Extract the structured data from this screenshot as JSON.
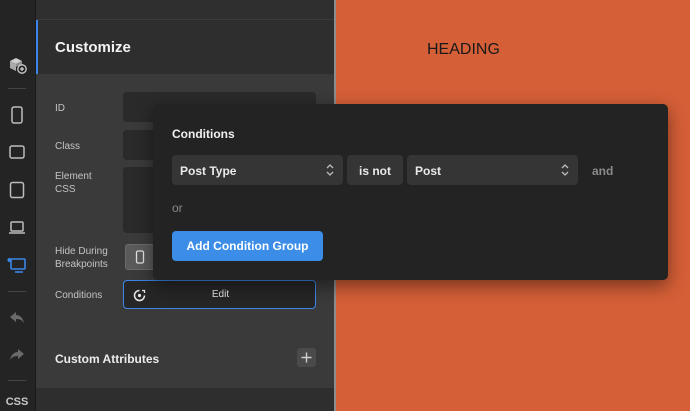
{
  "toolbar": {
    "icons": [
      "add-element-icon",
      "mobile-portrait-icon",
      "tablet-landscape-icon",
      "tablet-portrait-icon",
      "laptop-icon",
      "desktop-icon",
      "undo-icon",
      "redo-icon"
    ],
    "css_label": "CSS"
  },
  "panel": {
    "title": "Customize",
    "fields": {
      "id_label": "ID",
      "class_label": "Class",
      "element_css_label": "Element CSS",
      "hide_during_label": "Hide During Breakpoints",
      "conditions_label": "Conditions",
      "edit_label": "Edit"
    },
    "custom_attributes_label": "Custom Attributes"
  },
  "canvas": {
    "heading_text": "HEADING",
    "background_color": "#d55f37"
  },
  "conditions_popup": {
    "title": "Conditions",
    "field_select": "Post Type",
    "operator_select": "is not",
    "value_select": "Post",
    "and_label": "and",
    "or_label": "or",
    "add_group_label": "Add Condition Group"
  },
  "colors": {
    "accent": "#3b8de8"
  }
}
